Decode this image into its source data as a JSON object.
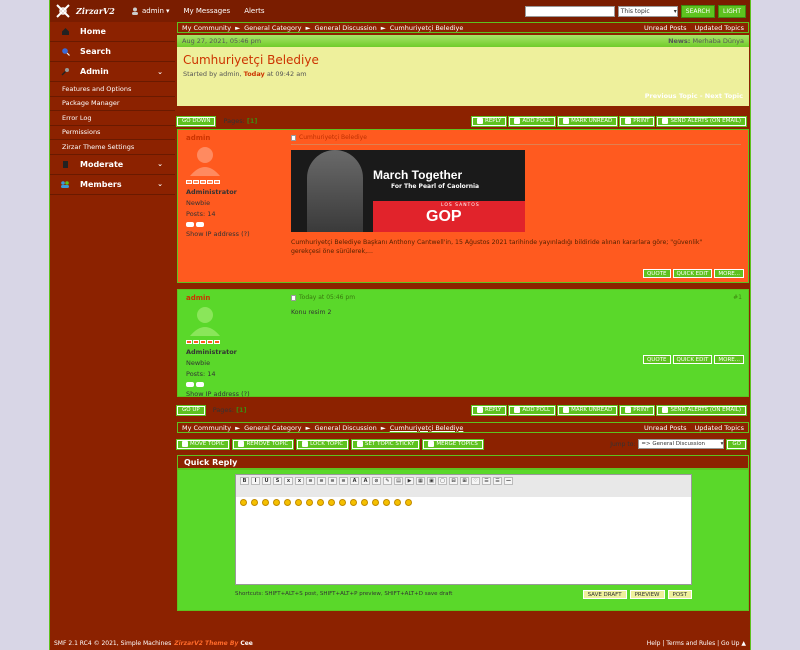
{
  "topbar": {
    "logo_text": "ZirzarV2",
    "username": "admin",
    "messages": "My Messages",
    "alerts": "Alerts",
    "search_scope": "This topic",
    "search_button": "SEARCH",
    "advanced_button": "LIGHT"
  },
  "sidebar": {
    "home": "Home",
    "search": "Search",
    "admin": "Admin",
    "admin_items": [
      "Features and Options",
      "Package Manager",
      "Error Log",
      "Permissions",
      "Zirzar Theme Settings"
    ],
    "moderate": "Moderate",
    "members": "Members"
  },
  "breadcrumb": {
    "items": [
      "My Community",
      "General Category",
      "General Discussion",
      "Cumhuriyetçi Belediye"
    ],
    "unread": "Unread Posts",
    "updated": "Updated Topics"
  },
  "datebar": {
    "date": "Aug 27, 2021, 05:46 pm",
    "news_label": "News:",
    "news_text": "Merhaba Dünya"
  },
  "topic": {
    "title": "Cumhuriyetçi Belediye",
    "started_prefix": "Started by admin,",
    "today": "Today",
    "started_suffix": "at 09:42 am",
    "prev_next": "Previous Topic - Next Topic"
  },
  "pagination": {
    "go_down": "GO DOWN",
    "go_up": "GO UP",
    "pages_label": "Pages:",
    "current": "[1]"
  },
  "topic_actions": [
    "REPLY",
    "ADD POLL",
    "MARK UNREAD",
    "PRINT",
    "SEND ALERTS (ON EMAIL)"
  ],
  "posts": [
    {
      "author": "admin",
      "role": "Administrator",
      "group": "Newbie",
      "posts": "Posts: 14",
      "show_ip": "Show IP address (?)",
      "subject": "Cumhuriyetçi Belediye",
      "banner_headline": "March Together",
      "banner_sub": "For The Pearl of Caolornia",
      "banner_ls": "LOS SANTOS",
      "banner_gop": "GOP",
      "body": "Cumhuriyetçi Belediye Başkanı Anthony Cantwell'in, 15 Ağustos 2021 tarihinde yayınladığı bildiride alınan kararlara göre; \"güvenlik\" gerekçesi öne sürülerek,...",
      "buttons": [
        "QUOTE",
        "QUICK EDIT",
        "MORE..."
      ]
    },
    {
      "author": "admin",
      "role": "Administrator",
      "group": "Newbie",
      "posts": "Posts: 14",
      "show_ip": "Show IP address (?)",
      "subject": "Today at 05:46 pm",
      "number": "#1",
      "body": "Konu resim 2",
      "buttons": [
        "QUOTE",
        "QUICK EDIT",
        "MORE..."
      ]
    }
  ],
  "moderation": {
    "buttons": [
      "MOVE TOPIC",
      "REMOVE TOPIC",
      "LOCK TOPIC",
      "SET TOPIC STICKY",
      "MERGE TOPICS"
    ],
    "jump_label": "Jump to:",
    "jump_value": "=> General Discussion",
    "go": "GO"
  },
  "quick_reply": {
    "title": "Quick Reply",
    "shortcuts": "Shortcuts: SHIFT+ALT+S post, SHIFT+ALT+P preview, SHIFT+ALT+D save draft",
    "buttons": [
      "SAVE DRAFT",
      "PREVIEW",
      "POST"
    ],
    "toolbar": [
      "B",
      "I",
      "U",
      "S",
      "x",
      "x",
      "≡",
      "≡",
      "≡",
      "≡",
      "A",
      "A",
      "⊘",
      "✎",
      "▤",
      "▶",
      "▦",
      "▣",
      "▢",
      "⊟",
      "⊞",
      "♡",
      "☰",
      "☰",
      "—"
    ]
  },
  "footer": {
    "left": "SMF 2.1 RC4 © 2021, Simple Machines",
    "theme": "ZirzarV2 Theme By",
    "author": "Cee",
    "right": "Help | Terms and Rules | Go Up ▲"
  },
  "colors": {
    "frame": "#8c2200",
    "accent_green": "#5ec21f",
    "post_orange": "#ff5a1f",
    "post_green": "#5ad82a",
    "title_bg": "#eef09c"
  }
}
